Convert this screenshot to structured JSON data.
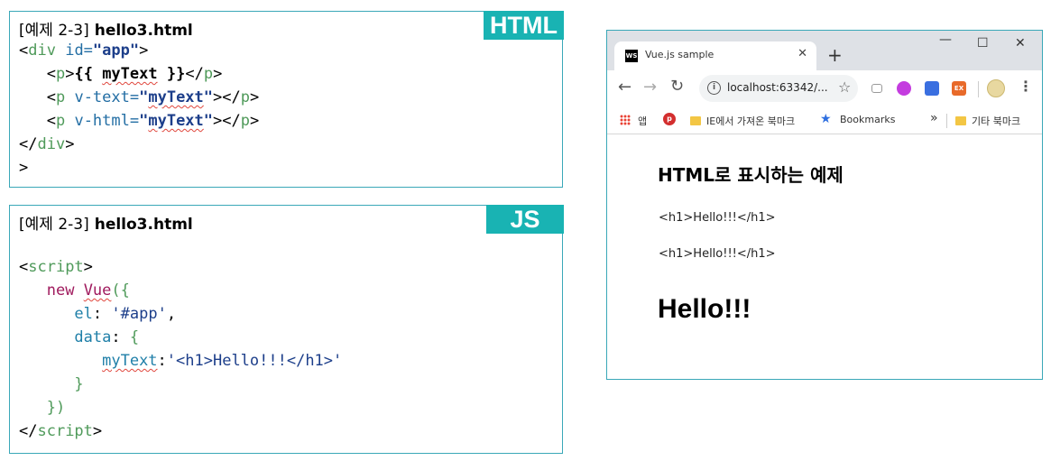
{
  "html_box": {
    "title_prefix": "[예제 2-3]",
    "filename": "hello3.html",
    "badge": "HTML",
    "lines": {
      "l1_open": "<",
      "l1_tag": "div",
      "l1_attr": " id=",
      "l1_val": "\"app\"",
      "l1_close": ">",
      "l2_indent": "   ",
      "l2_open": "<",
      "l2_tag": "p",
      "l2_close": ">",
      "l2_mus_open": "{{ ",
      "l2_mus_var": "myText",
      "l2_mus_close": " }}",
      "l2_end_open": "</",
      "l2_end_tag": "p",
      "l2_end_close": ">",
      "l3_indent": "   ",
      "l3_open": "<",
      "l3_tag": "p",
      "l3_attr": " v-text=",
      "l3_q1": "\"",
      "l3_var": "myText",
      "l3_q2": "\"",
      "l3_rest": "></",
      "l3_end_tag": "p",
      "l3_end": ">",
      "l4_indent": "   ",
      "l4_open": "<",
      "l4_tag": "p",
      "l4_attr": " v-html=",
      "l4_q1": "\"",
      "l4_var": "myText",
      "l4_q2": "\"",
      "l4_rest": "></",
      "l4_end_tag": "p",
      "l4_end": ">",
      "l5_open": "</",
      "l5_tag": "div",
      "l5_close": ">",
      "l6": ">"
    }
  },
  "js_box": {
    "title_prefix": "[예제 2-3]",
    "filename": "hello3.html",
    "badge": "JS",
    "lines": {
      "l1_open": "<",
      "l1_tag": "script",
      "l1_close": ">",
      "l2_indent": "   ",
      "l2_kw": "new",
      "l2_sp": " ",
      "l2_cls": "Vue",
      "l2_paren": "({",
      "l3_indent": "      ",
      "l3_key": "el",
      "l3_colon": ": ",
      "l3_val": "'#app'",
      "l3_comma": ",",
      "l4_indent": "      ",
      "l4_key": "data",
      "l4_colon": ": ",
      "l4_brace": "{",
      "l5_indent": "         ",
      "l5_key": "myText",
      "l5_colon": ":",
      "l5_val": "'<h1>Hello!!!</h1>'",
      "l6_indent": "      ",
      "l6_brace": "}",
      "l7_indent": "   ",
      "l7_close": "})",
      "l8_open": "</",
      "l8_tag": "script",
      "l8_close": ">"
    }
  },
  "browser": {
    "tab_favicon": "WS",
    "tab_title": "Vue.js sample",
    "tab_close": "✕",
    "new_tab": "+",
    "win_minimize": "—",
    "win_maximize": "☐",
    "win_close": "✕",
    "back": "←",
    "forward": "→",
    "reload": "↻",
    "info": "i",
    "url": "localhost:63342/...",
    "star": "☆",
    "ext_label": "EX",
    "menu": "⋮",
    "bookmarks": {
      "apps": "앱",
      "pin": "p",
      "ie_folder": "IE에서 가져온 북마크",
      "star": "★",
      "bookmarks": "Bookmarks",
      "more": "»",
      "other": "기타 북마크"
    },
    "page": {
      "heading": "HTML로 표시하는 예제",
      "p1": "<h1>Hello!!!</h1>",
      "p2": "<h1>Hello!!!</h1>",
      "hello": "Hello!!!"
    }
  }
}
